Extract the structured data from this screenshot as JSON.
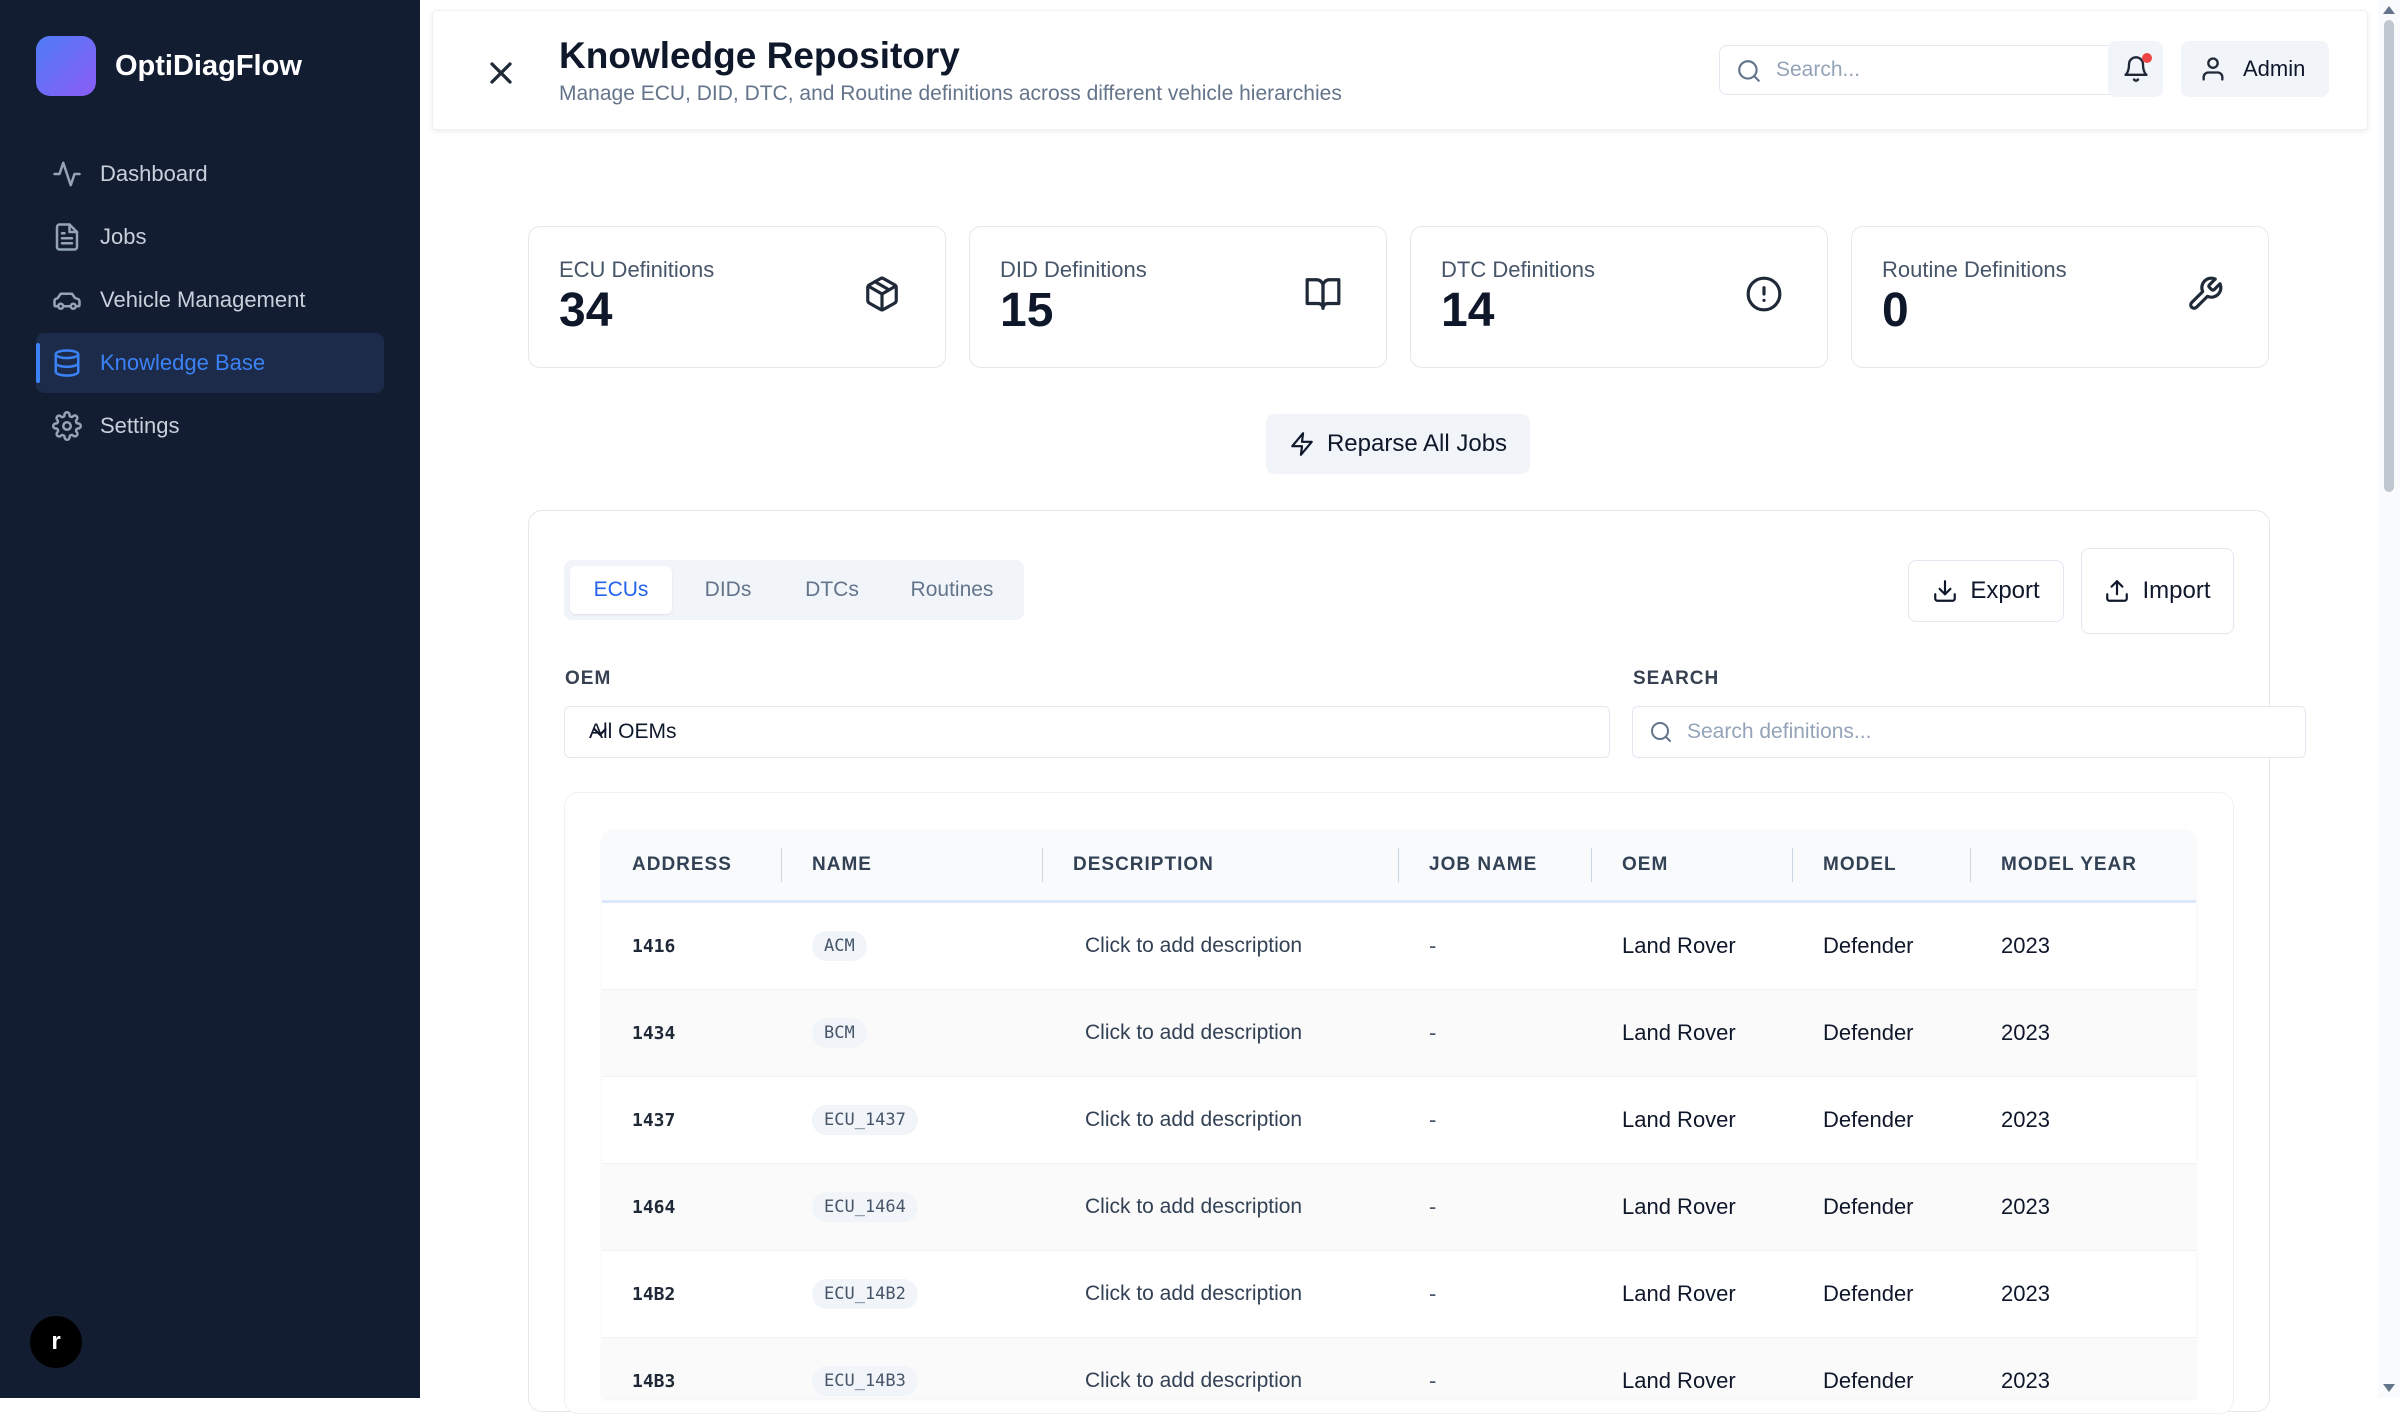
{
  "app": {
    "name": "OptiDiagFlow"
  },
  "sidebar": {
    "items": [
      {
        "label": "Dashboard",
        "icon": "activity-icon",
        "active": false
      },
      {
        "label": "Jobs",
        "icon": "file-text-icon",
        "active": false
      },
      {
        "label": "Vehicle Management",
        "icon": "car-icon",
        "active": false
      },
      {
        "label": "Knowledge Base",
        "icon": "database-icon",
        "active": true
      },
      {
        "label": "Settings",
        "icon": "gear-icon",
        "active": false
      }
    ],
    "user_initial": "r"
  },
  "header": {
    "title": "Knowledge Repository",
    "subtitle": "Manage ECU, DID, DTC, and Routine definitions across different vehicle hierarchies",
    "search_placeholder": "Search...",
    "user_label": "Admin",
    "has_notification": true
  },
  "stats": [
    {
      "label": "ECU Definitions",
      "value": "34",
      "icon": "package-icon"
    },
    {
      "label": "DID Definitions",
      "value": "15",
      "icon": "book-open-icon"
    },
    {
      "label": "DTC Definitions",
      "value": "14",
      "icon": "alert-circle-icon"
    },
    {
      "label": "Routine Definitions",
      "value": "0",
      "icon": "wrench-icon"
    }
  ],
  "actions": {
    "reparse_label": "Reparse All Jobs",
    "export_label": "Export",
    "import_label": "Import"
  },
  "tabs": [
    {
      "label": "ECUs",
      "active": true
    },
    {
      "label": "DIDs",
      "active": false
    },
    {
      "label": "DTCs",
      "active": false
    },
    {
      "label": "Routines",
      "active": false
    }
  ],
  "filters": {
    "oem_label": "OEM",
    "oem_value": "All OEMs",
    "search_label": "SEARCH",
    "search_placeholder": "Search definitions..."
  },
  "table": {
    "columns": [
      "ADDRESS",
      "NAME",
      "DESCRIPTION",
      "JOB NAME",
      "OEM",
      "MODEL",
      "MODEL YEAR"
    ],
    "rows": [
      {
        "address": "1416",
        "name": "ACM",
        "description": "Click to add description",
        "job_name": "-",
        "oem": "Land Rover",
        "model": "Defender",
        "model_year": "2023"
      },
      {
        "address": "1434",
        "name": "BCM",
        "description": "Click to add description",
        "job_name": "-",
        "oem": "Land Rover",
        "model": "Defender",
        "model_year": "2023"
      },
      {
        "address": "1437",
        "name": "ECU_1437",
        "description": "Click to add description",
        "job_name": "-",
        "oem": "Land Rover",
        "model": "Defender",
        "model_year": "2023"
      },
      {
        "address": "1464",
        "name": "ECU_1464",
        "description": "Click to add description",
        "job_name": "-",
        "oem": "Land Rover",
        "model": "Defender",
        "model_year": "2023"
      },
      {
        "address": "14B2",
        "name": "ECU_14B2",
        "description": "Click to add description",
        "job_name": "-",
        "oem": "Land Rover",
        "model": "Defender",
        "model_year": "2023"
      },
      {
        "address": "14B3",
        "name": "ECU_14B3",
        "description": "Click to add description",
        "job_name": "-",
        "oem": "Land Rover",
        "model": "Defender",
        "model_year": "2023"
      }
    ]
  },
  "colors": {
    "sidebar_bg": "#131d32",
    "accent": "#3b82f6",
    "notification_dot": "#ef4444"
  }
}
